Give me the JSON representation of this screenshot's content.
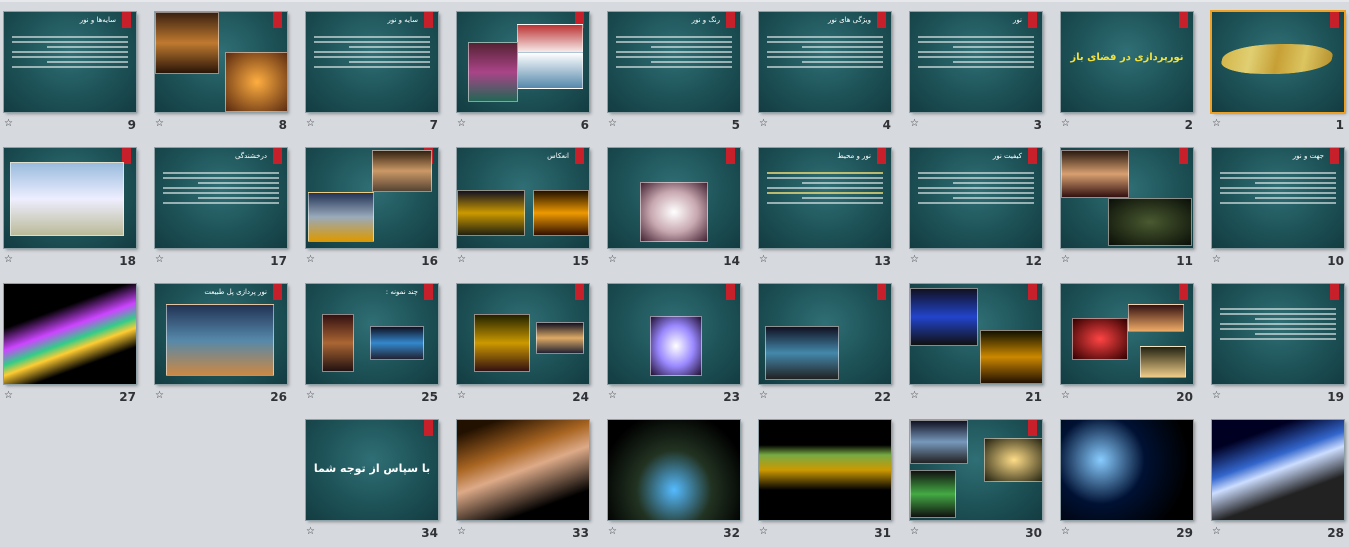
{
  "slides": [
    {
      "num": "1",
      "title": "",
      "text": "",
      "kind": "callig"
    },
    {
      "num": "2",
      "title": "",
      "text": "نورپردازی در فضای باز",
      "kind": "center"
    },
    {
      "num": "3",
      "title": "نور",
      "text": "",
      "kind": "text"
    },
    {
      "num": "4",
      "title": "ویژگی های نور",
      "text": "",
      "kind": "text"
    },
    {
      "num": "5",
      "title": "رنگ و نور",
      "text": "",
      "kind": "text"
    },
    {
      "num": "6",
      "title": "",
      "text": "",
      "kind": "photos"
    },
    {
      "num": "7",
      "title": "سایه و نور",
      "text": "",
      "kind": "text"
    },
    {
      "num": "8",
      "title": "",
      "text": "",
      "kind": "photos"
    },
    {
      "num": "9",
      "title": "سایه‌ها و نور",
      "text": "",
      "kind": "text"
    },
    {
      "num": "10",
      "title": "جهت و نور",
      "text": "",
      "kind": "text"
    },
    {
      "num": "11",
      "title": "",
      "text": "",
      "kind": "photos"
    },
    {
      "num": "12",
      "title": "کیفیت نور",
      "text": "",
      "kind": "text"
    },
    {
      "num": "13",
      "title": "نور و محیط",
      "text": "",
      "kind": "text"
    },
    {
      "num": "14",
      "title": "",
      "text": "",
      "kind": "photos"
    },
    {
      "num": "15",
      "title": "انعکاس",
      "text": "",
      "kind": "photos"
    },
    {
      "num": "16",
      "title": "",
      "text": "",
      "kind": "photos"
    },
    {
      "num": "17",
      "title": "درخشندگی",
      "text": "",
      "kind": "text"
    },
    {
      "num": "18",
      "title": "",
      "text": "",
      "kind": "photos"
    },
    {
      "num": "19",
      "title": "",
      "text": "",
      "kind": "text"
    },
    {
      "num": "20",
      "title": "",
      "text": "",
      "kind": "photos"
    },
    {
      "num": "21",
      "title": "",
      "text": "",
      "kind": "photos"
    },
    {
      "num": "22",
      "title": "",
      "text": "",
      "kind": "photos"
    },
    {
      "num": "23",
      "title": "",
      "text": "",
      "kind": "photos"
    },
    {
      "num": "24",
      "title": "",
      "text": "",
      "kind": "photos"
    },
    {
      "num": "25",
      "title": "چند نمونه :",
      "text": "",
      "kind": "photos"
    },
    {
      "num": "26",
      "title": "نور پردازی پل طبیعت",
      "text": "",
      "kind": "photos"
    },
    {
      "num": "27",
      "title": "",
      "text": "",
      "kind": "black"
    },
    {
      "num": "28",
      "title": "",
      "text": "",
      "kind": "black"
    },
    {
      "num": "29",
      "title": "",
      "text": "",
      "kind": "black"
    },
    {
      "num": "30",
      "title": "",
      "text": "",
      "kind": "photos"
    },
    {
      "num": "31",
      "title": "",
      "text": "",
      "kind": "black"
    },
    {
      "num": "32",
      "title": "",
      "text": "",
      "kind": "black"
    },
    {
      "num": "33",
      "title": "",
      "text": "",
      "kind": "black"
    },
    {
      "num": "34",
      "title": "",
      "text": "با سپاس از توجه شما",
      "kind": "thanks"
    }
  ]
}
